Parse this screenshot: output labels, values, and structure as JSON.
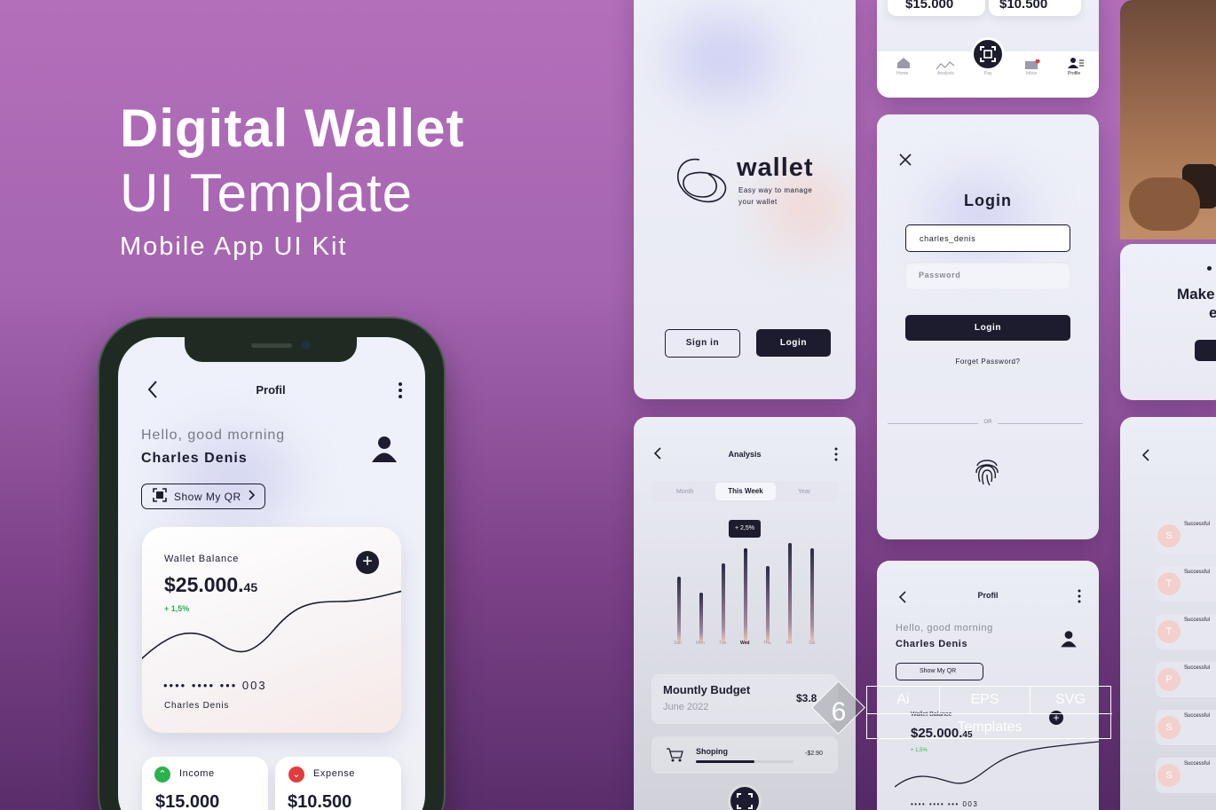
{
  "hero": {
    "title": "Digital Wallet",
    "subtitle": "UI Template",
    "kit": "Mobile App UI Kit"
  },
  "phone": {
    "title": "Profil",
    "greeting": "Hello, good morning",
    "name": "Charles Denis",
    "qr_button": "Show My QR",
    "wallet_label": "Wallet Balance",
    "wallet_amount": "$25.000.",
    "wallet_cents": "45",
    "wallet_change": "+ 1,5%",
    "card_number": "•••• •••• ••• 003",
    "card_owner": "Charles Denis",
    "income_label": "Income",
    "income_value": "$15.000",
    "expense_label": "Expense",
    "expense_value": "$10.500"
  },
  "top_strip": {
    "value_a": "$15.000",
    "value_b": "$10.500",
    "nav": [
      "Home",
      "Analysis",
      "Pay",
      "Inbox",
      "Profile"
    ]
  },
  "splash": {
    "brand": "wallet",
    "tagline_1": "Easy way to manage",
    "tagline_2": "your wallet",
    "sign_in": "Sign in",
    "login": "Login"
  },
  "login": {
    "title": "Login",
    "username_value": "charles_denis",
    "password_placeholder": "Password",
    "button": "Login",
    "forgot": "Forget Password?",
    "or": "OR"
  },
  "analysis": {
    "title": "Analysis",
    "tabs": [
      "Month",
      "This Week",
      "Year"
    ],
    "tooltip": "+ 2,5%",
    "days": [
      "Sun",
      "Mon",
      "Tue",
      "Wed",
      "Thu",
      "Fri",
      "Sat"
    ],
    "budget_title": "Mountly Budget",
    "budget_date": "June 2022",
    "budget_value": "$3.8",
    "shop_label": "Shoping",
    "shop_value": "-$2.90"
  },
  "profile_small": {
    "title": "Profil",
    "greeting": "Hello, good morning",
    "name": "Charles Denis",
    "qr_button": "Show My QR",
    "wallet_label": "Wallet Balance",
    "wallet_amount": "$25.000.",
    "wallet_cents": "45",
    "change": "+ 1,5%",
    "card": "•••• •••• ••• 003"
  },
  "right_partial": {
    "make": "Make",
    "e": "e",
    "list_label": "Successful",
    "list_initials": [
      "S",
      "T",
      "T",
      "P",
      "S",
      "S"
    ]
  },
  "badge": {
    "count": "6",
    "formats": [
      "Ai",
      "EPS",
      "SVG"
    ],
    "label": "Templates"
  }
}
